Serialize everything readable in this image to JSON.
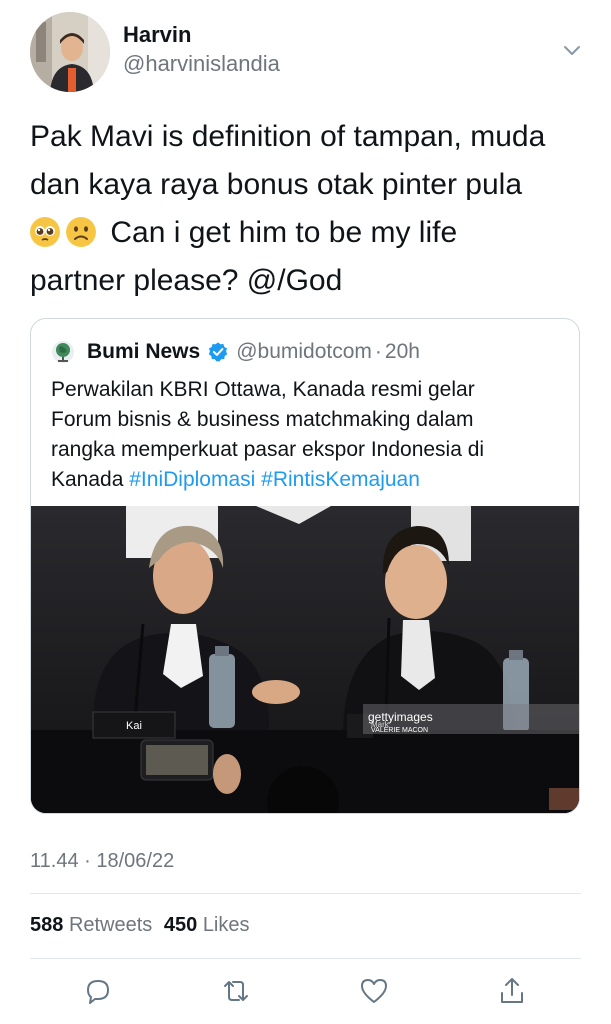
{
  "user": {
    "name": "Harvin",
    "handle": "@harvinislandia"
  },
  "tweet": {
    "line1": "Pak Mavi is definition of tampan, muda",
    "line2": "dan kaya raya bonus otak pinter pula",
    "line3": "Can i get him to be my life",
    "line4": "partner please? @/God"
  },
  "quoted": {
    "name": "Bumi News",
    "handle": "@bumidotcom",
    "dot": "·",
    "time": "20h",
    "line1": "Perwakilan KBRI Ottawa, Kanada resmi gelar",
    "line2": "Forum bisnis & business matchmaking dalam",
    "line3": "rangka memperkuat pasar ekspor Indonesia di",
    "line4_plain": "Kanada",
    "tag1": "#IniDiplomasi",
    "tag2": "#RintisKemajuan",
    "image": {
      "nameplate": "Kai",
      "watermark": "gettyimages",
      "credit": "VALERIE MACON",
      "overlay": "Mark"
    }
  },
  "meta": {
    "timestamp": "11.44 · 18/06/22"
  },
  "stats": {
    "retweets": "588",
    "retweets_label": "Retweets",
    "likes": "450",
    "likes_label": "Likes"
  },
  "icons": {
    "reply": "reply-icon",
    "retweet": "retweet-icon",
    "like": "like-icon",
    "share": "share-icon",
    "menu": "chevron-down-icon",
    "verified": "verified-badge-icon",
    "emoji1": "pleading-face-emoji",
    "emoji2": "frowning-face-emoji"
  },
  "colors": {
    "link": "#1d9bf0",
    "muted": "#6e767d",
    "text": "#0f1419",
    "verified": "#1d9bf0"
  }
}
